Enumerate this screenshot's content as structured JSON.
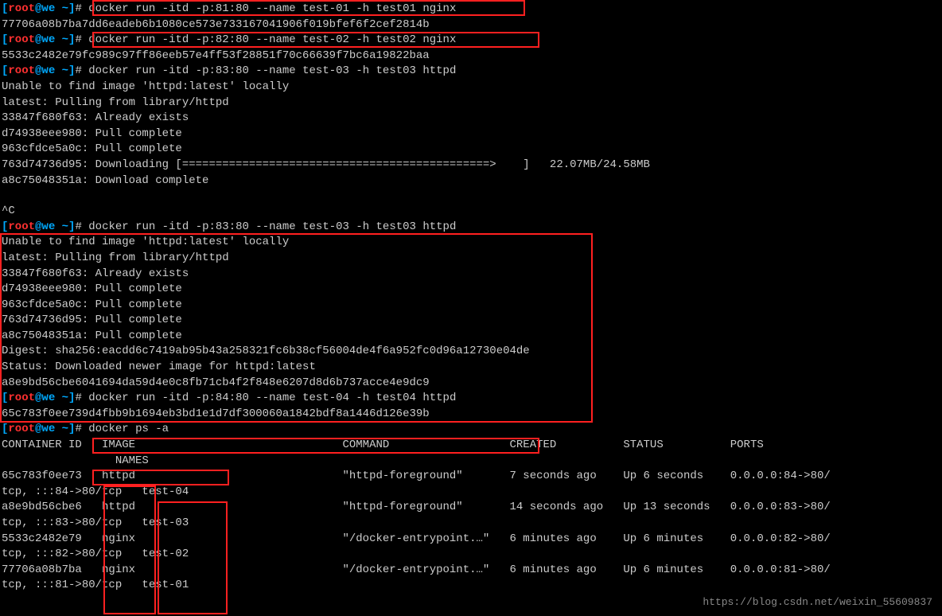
{
  "prompt": {
    "open": "[",
    "user": "root",
    "at": "@",
    "host": "we",
    "tilde": " ~",
    "close": "]",
    "hash": "# "
  },
  "cmd1": "docker run -itd -p:81:80 --name test-01 -h test01 nginx",
  "out1": "77706a08b7ba7dd6eadeb6b1080ce573e733167041906f019bfef6f2cef2814b",
  "cmd2": "docker run -itd -p:82:80 --name test-02 -h test02 nginx",
  "out2": "5533c2482e79fc989c97ff86eeb57e4ff53f28851f70c66639f7bc6a19822baa",
  "cmd3": "docker run -itd -p:83:80 --name test-03 -h test03 httpd",
  "pull1": [
    "Unable to find image 'httpd:latest' locally",
    "latest: Pulling from library/httpd",
    "33847f680f63: Already exists",
    "d74938eee980: Pull complete",
    "963cfdce5a0c: Pull complete",
    "763d74736d95: Downloading [==============================================>    ]   22.07MB/24.58MB",
    "a8c75048351a: Download complete"
  ],
  "ctrlc": "^C",
  "cmd4": "docker run -itd -p:83:80 --name test-03 -h test03 httpd",
  "pull2": [
    "Unable to find image 'httpd:latest' locally",
    "latest: Pulling from library/httpd",
    "33847f680f63: Already exists",
    "d74938eee980: Pull complete",
    "963cfdce5a0c: Pull complete",
    "763d74736d95: Pull complete",
    "a8c75048351a: Pull complete",
    "Digest: sha256:eacdd6c7419ab95b43a258321fc6b38cf56004de4f6a952fc0d96a12730e04de",
    "Status: Downloaded newer image for httpd:latest"
  ],
  "out4": "a8e9bd56cbe6041694da59d4e0c8fb71cb4f2f848e6207d8d6b737acce4e9dc9",
  "cmd5": "docker run -itd -p:84:80 --name test-04 -h test04 httpd",
  "out5": "65c783f0ee739d4fbb9b1694eb3bd1e1d7df300060a1842bdf8a1446d126e39b",
  "cmd6": "docker ps -a",
  "ps_header": "CONTAINER ID   IMAGE                               COMMAND                  CREATED          STATUS          PORTS",
  "ps_header2": "                 NAMES",
  "ps": [
    {
      "a": "65c783f0ee73   httpd                               \"httpd-foreground\"       7 seconds ago    Up 6 seconds    0.0.0.0:84->80/",
      "b": "tcp, :::84->80/tcp   test-04"
    },
    {
      "a": "a8e9bd56cbe6   httpd                               \"httpd-foreground\"       14 seconds ago   Up 13 seconds   0.0.0.0:83->80/",
      "b": "tcp, :::83->80/tcp   test-03"
    },
    {
      "a": "5533c2482e79   nginx                               \"/docker-entrypoint.…\"   6 minutes ago    Up 6 minutes    0.0.0.0:82->80/",
      "b": "tcp, :::82->80/tcp   test-02"
    },
    {
      "a": "77706a08b7ba   nginx                               \"/docker-entrypoint.…\"   6 minutes ago    Up 6 minutes    0.0.0.0:81->80/",
      "b": "tcp, :::81->80/tcp   test-01"
    }
  ],
  "watermark": "https://blog.csdn.net/weixin_55609837"
}
